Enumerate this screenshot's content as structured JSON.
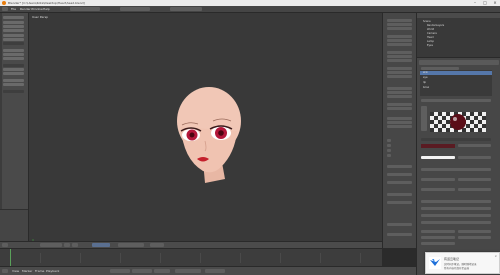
{
  "window": {
    "title": "Blender* [C:\\Users\\Kota\\Desktop\\Head\\head.blend]",
    "minimize": "–",
    "maximize": "□",
    "close": "×"
  },
  "menu": [
    "File",
    "Render",
    "Window",
    "Help"
  ],
  "viewport": {
    "view_label": "User Persp",
    "object_label": "(1) Head"
  },
  "timeline_labels": [
    "View",
    "Marker",
    "Frame",
    "Playback"
  ],
  "outliner": {
    "rows": [
      "Scene",
      "RenderLayers",
      "World",
      "Camera",
      "Head",
      "Lamp",
      "Eyes"
    ]
  },
  "materials": {
    "items": [
      "skin",
      "eye",
      "lip",
      "brow"
    ]
  },
  "notification": {
    "title": "有道云笔记",
    "line1": "实时同步笔记，随时随地记录",
    "line2": "所有内容已保存至云端",
    "close": "×"
  },
  "colors": {
    "accent": "#5577aa",
    "skin": "#f1c7b6",
    "iris": "#b3173a",
    "lips": "#c4202c"
  }
}
